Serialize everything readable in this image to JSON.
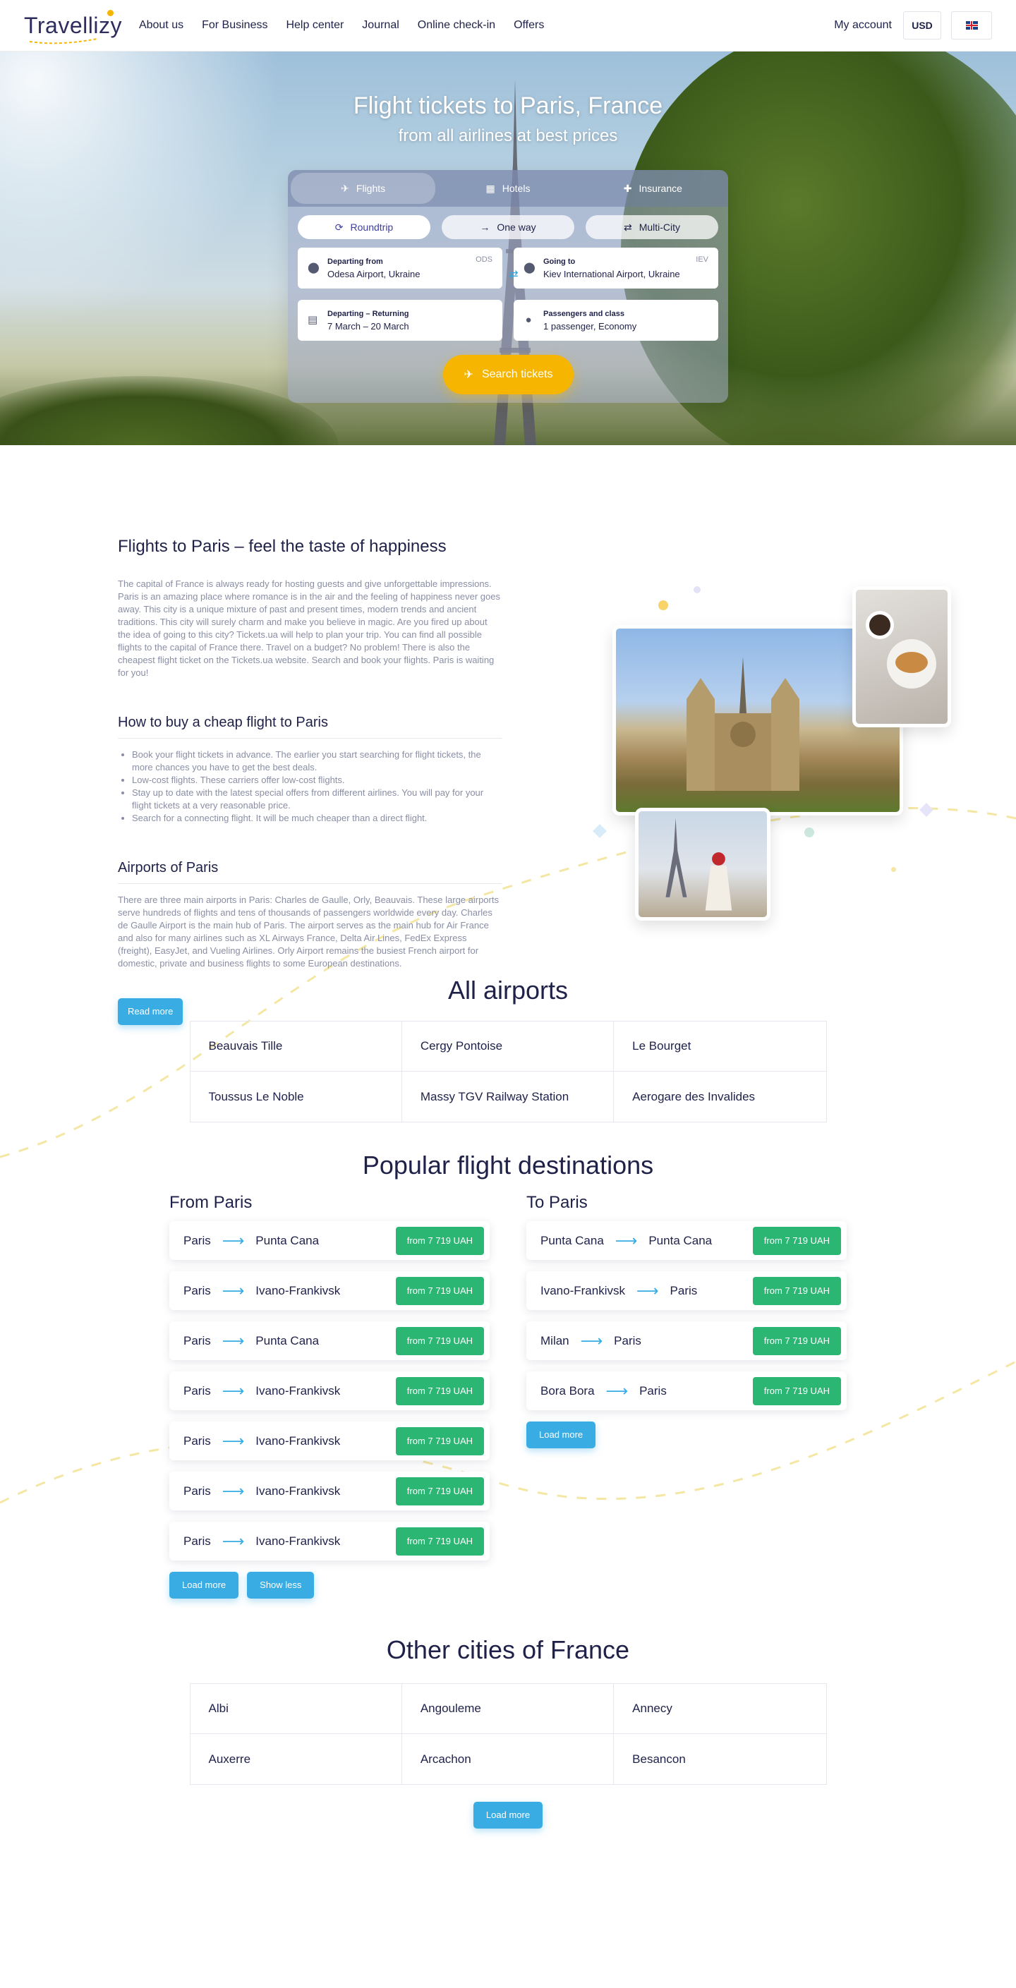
{
  "header": {
    "logo": "Travellizy",
    "nav": [
      "About us",
      "For Business",
      "Help center",
      "Journal",
      "Online check-in",
      "Offers"
    ],
    "account": "My account",
    "currency": "USD",
    "language_flag": "uk-flag-icon"
  },
  "hero": {
    "title": "Flight tickets to Paris, France",
    "subtitle": "from all airlines at best prices",
    "tabs": [
      {
        "label": "Flights",
        "icon": "plane-icon",
        "active": true
      },
      {
        "label": "Hotels",
        "icon": "hotel-icon",
        "active": false
      },
      {
        "label": "Insurance",
        "icon": "insurance-icon",
        "active": false
      }
    ],
    "trip_types": [
      {
        "label": "Roundtrip",
        "icon": "refresh-icon",
        "active": true
      },
      {
        "label": "One way",
        "icon": "arrow-right-icon",
        "active": false
      },
      {
        "label": "Multi-City",
        "icon": "swap-arrows-icon",
        "active": false
      }
    ],
    "departing": {
      "label": "Departing from",
      "value": "Odesa Airport, Ukraine",
      "code": "ODS"
    },
    "going": {
      "label": "Going to",
      "value": "Kiev International Airport, Ukraine",
      "code": "IEV"
    },
    "dates": {
      "label": "Departing – Returning",
      "value": "7 March – 20 March"
    },
    "passengers": {
      "label": "Passengers and class",
      "value": "1 passenger, Economy"
    },
    "search_button": "Search tickets",
    "colors": {
      "accent": "#f6b500",
      "primary": "#3aace4",
      "price": "#2bb673"
    }
  },
  "intro": {
    "title": "Flights to Paris – feel the taste of happiness",
    "text": "The capital of France is always ready for hosting guests and give unforgettable impressions. Paris is an amazing place where romance is in the air and the feeling of happiness never goes away. This city is a unique mixture of past and present times, modern trends and ancient traditions. This city will surely charm and make you believe in magic. Are you fired up about the idea of going to this city? Tickets.ua will help to plan your trip. You can find all possible flights to the capital of France there. Travel on a budget? No problem! There is also the cheapest flight ticket on the Tickets.ua website. Search and book your flights. Paris is waiting for you!",
    "howto_title": "How to buy a cheap flight to Paris",
    "howto_items": [
      "Book your flight tickets in advance. The earlier you start searching for flight tickets, the more chances you have to get the best deals.",
      "Low-cost flights. These carriers offer low-cost flights.",
      "Stay up to date with the latest special offers from different airlines. You will pay for your flight tickets at a very reasonable price.",
      "Search for a connecting flight. It will be much cheaper than a direct flight."
    ],
    "airports_title": "Airports of Paris",
    "airports_text": "There are three main airports in Paris: Charles de Gaulle, Orly, Beauvais. These large airports serve hundreds of flights and tens of thousands of passengers worldwide every day. Charles de Gaulle Airport is the main hub of Paris. The airport serves as the main hub for Air France and also for many airlines such as XL Airways France, Delta Air Lines, FedEx Express (freight), EasyJet, and Vueling Airlines. Orly Airport remains the busiest French airport for domestic, private and business flights to some European destinations.",
    "read_more": "Read more"
  },
  "all_airports": {
    "title": "All airports",
    "items": [
      "Beauvais Tille",
      "Cergy Pontoise",
      "Le Bourget",
      "Toussus Le Noble",
      "Massy TGV Railway Station",
      "Aerogare des Invalides"
    ]
  },
  "popular": {
    "title": "Popular flight destinations",
    "from_title": "From Paris",
    "to_title": "To Paris",
    "from": [
      {
        "from": "Paris",
        "to": "Punta Cana",
        "price": "from 7 719 UAH"
      },
      {
        "from": "Paris",
        "to": "Ivano-Frankivsk",
        "price": "from 7 719 UAH"
      },
      {
        "from": "Paris",
        "to": "Punta Cana",
        "price": "from 7 719 UAH"
      },
      {
        "from": "Paris",
        "to": "Ivano-Frankivsk",
        "price": "from 7 719 UAH"
      },
      {
        "from": "Paris",
        "to": "Ivano-Frankivsk",
        "price": "from 7 719 UAH"
      },
      {
        "from": "Paris",
        "to": "Ivano-Frankivsk",
        "price": "from 7 719 UAH"
      },
      {
        "from": "Paris",
        "to": "Ivano-Frankivsk",
        "price": "from 7 719 UAH"
      }
    ],
    "to": [
      {
        "from": "Punta Cana",
        "to": "Punta Cana",
        "price": "from 7 719 UAH"
      },
      {
        "from": "Ivano-Frankivsk",
        "to": "Paris",
        "price": "from 7 719 UAH"
      },
      {
        "from": "Milan",
        "to": "Paris",
        "price": "from 7 719 UAH"
      },
      {
        "from": "Bora Bora",
        "to": "Paris",
        "price": "from 7 719 UAH"
      }
    ],
    "load_more": "Load more",
    "show_less": "Show less"
  },
  "other_cities": {
    "title": "Other cities of France",
    "items": [
      "Albi",
      "Angouleme",
      "Annecy",
      "Auxerre",
      "Arcachon",
      "Besancon"
    ],
    "load_more": "Load more"
  }
}
